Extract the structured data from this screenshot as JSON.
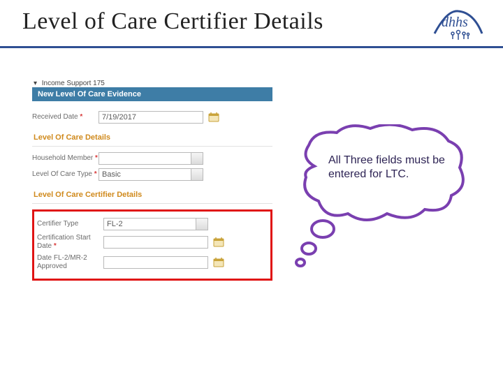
{
  "header": {
    "title": "Level of Care Certifier Details",
    "logo_name": "dhhs-logo"
  },
  "breadcrumb": {
    "label": "Income Support 175"
  },
  "panel": {
    "title": "New Level Of Care Evidence"
  },
  "received": {
    "label": "Received Date",
    "value": "7/19/2017"
  },
  "section_loc": {
    "heading": "Level Of Care Details",
    "household_label": "Household Member",
    "household_value": "",
    "loc_type_label": "Level Of Care Type",
    "loc_type_value": "Basic"
  },
  "section_cert": {
    "heading": "Level Of Care Certifier Details",
    "certifier_type_label": "Certifier Type",
    "certifier_type_value": "FL-2",
    "cert_start_label": "Certification Start Date",
    "cert_start_value": "",
    "fl2_approved_label": "Date FL-2/MR-2 Approved",
    "fl2_approved_value": ""
  },
  "callout": {
    "text": "All Three fields must be entered for LTC."
  }
}
